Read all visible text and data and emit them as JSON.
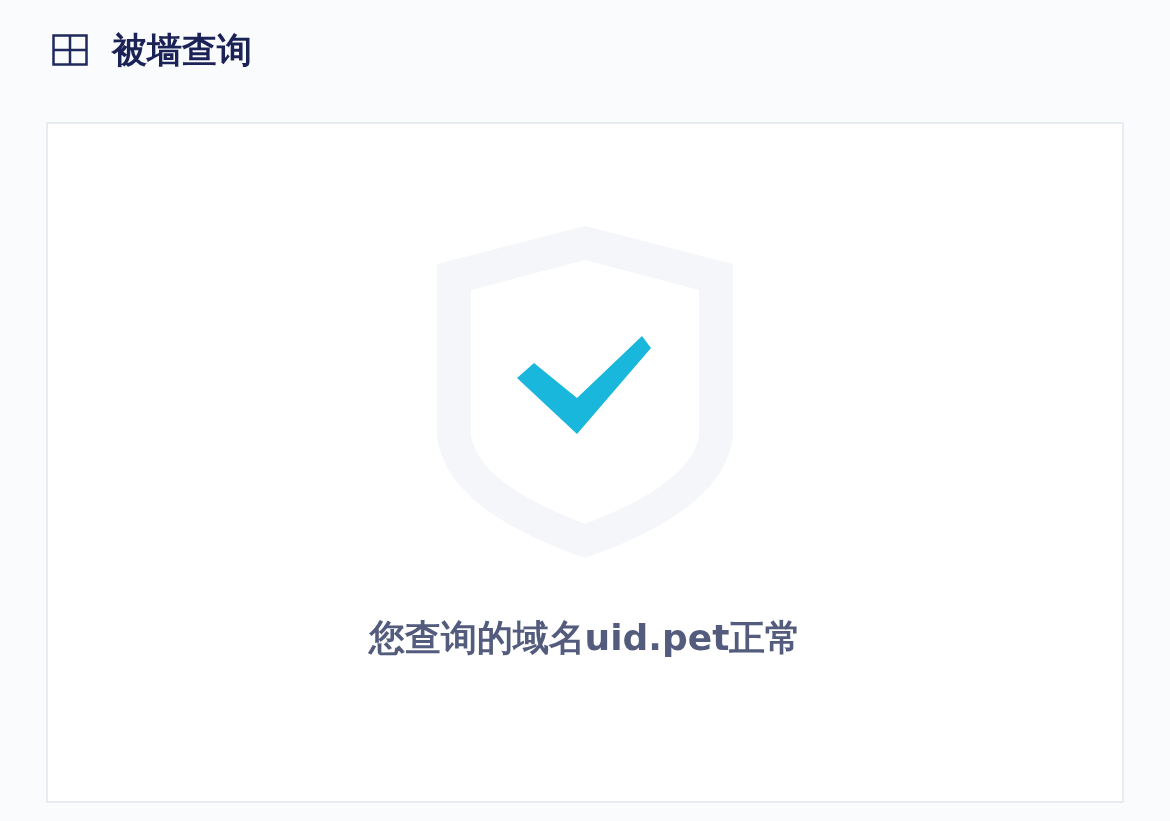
{
  "header": {
    "title": "被墙查询"
  },
  "result": {
    "kind": "ok",
    "message": "您查询的域名uid.pet正常"
  }
}
